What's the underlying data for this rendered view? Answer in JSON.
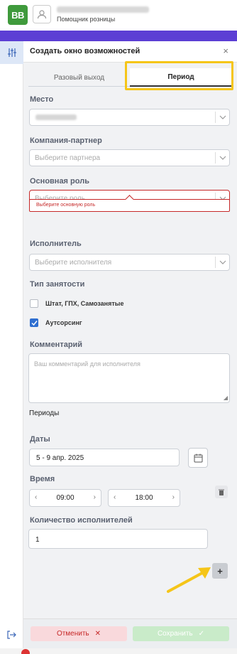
{
  "header": {
    "logo": "BB",
    "user_role": "Помощник розницы"
  },
  "panel": {
    "title": "Создать окно возможностей",
    "close": "×",
    "tabs": [
      {
        "label": "Разовый выход",
        "active": false
      },
      {
        "label": "Период",
        "active": true
      }
    ]
  },
  "form": {
    "place_label": "Место",
    "partner_label": "Компания-партнер",
    "partner_placeholder": "Выберите партнера",
    "role_label": "Основная роль",
    "role_placeholder": "Выберите роль",
    "role_error": "Выберите основную роль",
    "executor_label": "Исполнитель",
    "executor_placeholder": "Выберите исполнителя",
    "employment_label": "Тип занятости",
    "employment_options": [
      {
        "label": "Штат, ГПХ, Самозанятые",
        "checked": false
      },
      {
        "label": "Аутсорсинг",
        "checked": true
      }
    ],
    "comment_label": "Комментарий",
    "comment_placeholder": "Ваш комментарий для исполнителя"
  },
  "periods": {
    "section_title": "Периоды",
    "dates_label": "Даты",
    "dates_value": "5 - 9 апр. 2025",
    "time_label": "Время",
    "time_from": "09:00",
    "time_to": "18:00",
    "count_label": "Количество исполнителей",
    "count_value": "1",
    "add_button": "+"
  },
  "footer": {
    "cancel_label": "Отменить",
    "save_label": "Сохранить"
  },
  "colors": {
    "accent_bar": "#5c3fd4",
    "logo_green": "#3f9a3c",
    "error_red": "#c62828",
    "highlight_yellow": "#f5c518",
    "checkbox_blue": "#2f6fd0"
  }
}
